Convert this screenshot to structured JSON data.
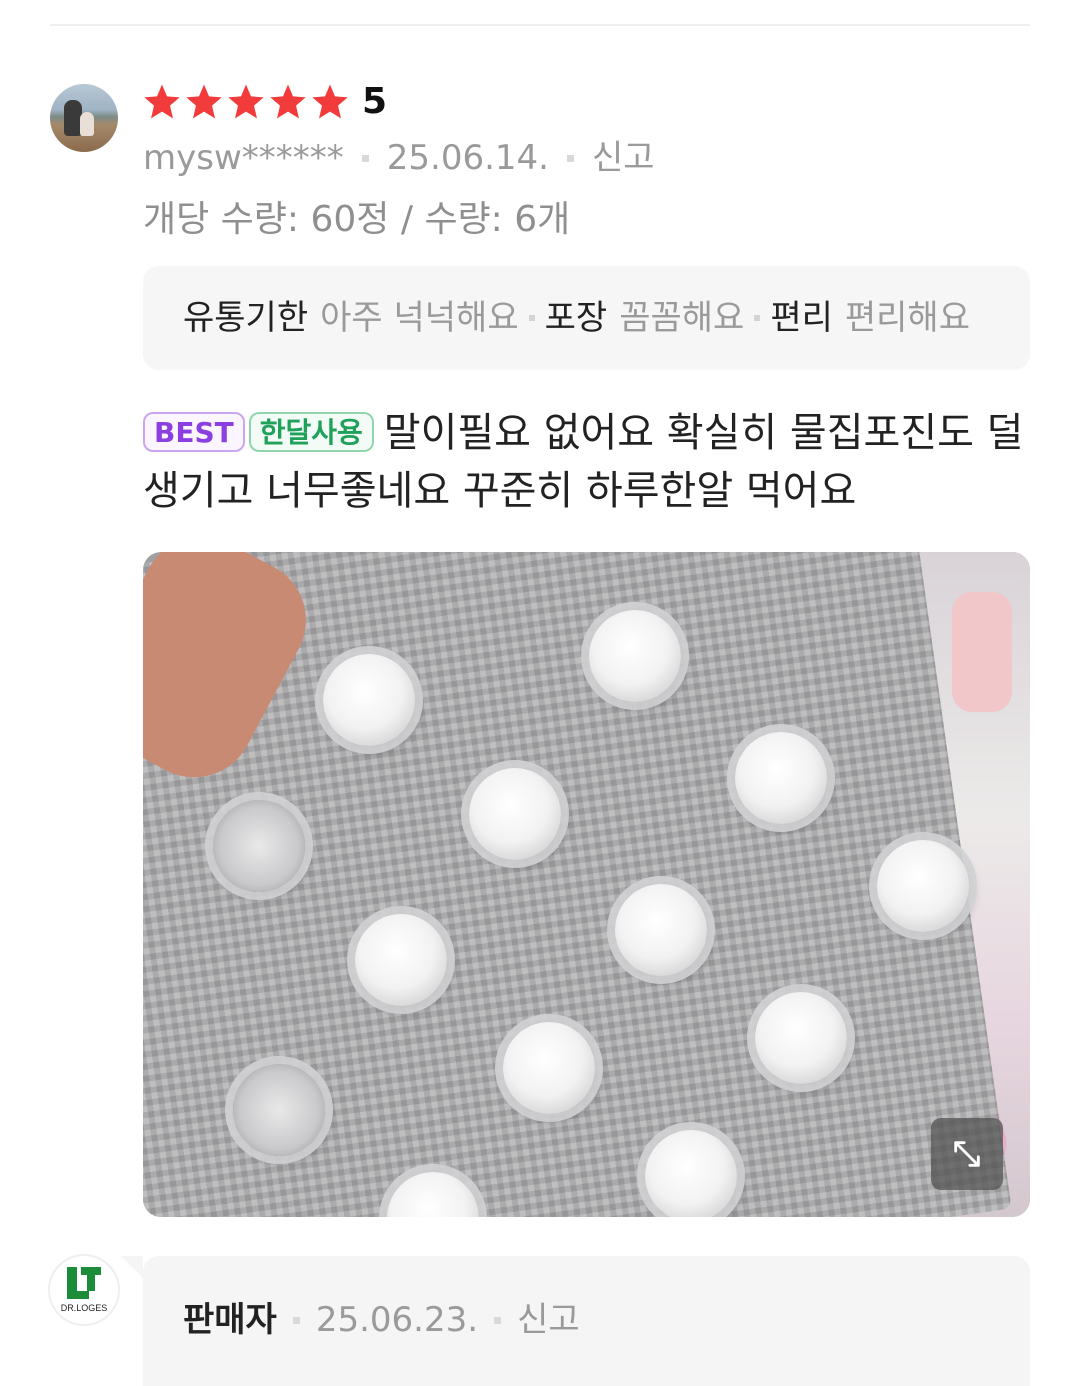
{
  "review": {
    "rating": 5,
    "rating_display": "5",
    "star_color": "#f23b3b",
    "user_id": "mysw******",
    "date": "25.06.14.",
    "report_label": "신고",
    "option_info": "개당 수량: 60정 / 수량: 6개",
    "attributes": [
      {
        "key": "유통기한",
        "value": "아주 넉넉해요"
      },
      {
        "key": "포장",
        "value": "꼼꼼해요"
      },
      {
        "key": "편리",
        "value": "편리해요"
      }
    ],
    "badges": {
      "best": "BEST",
      "month_use": "한달사용"
    },
    "text": "말이필요 없어요 확실히 물집포진도 덜생기고 너무좋네요 꾸준히 하루한알 먹어요",
    "photo": {
      "description_icon": "expand-icon"
    }
  },
  "seller_reply": {
    "logo_text": "DR.LOGES",
    "seller_label": "판매자",
    "date": "25.06.23.",
    "report_label": "신고"
  },
  "colors": {
    "best_badge": "#8b3fe0",
    "month_badge": "#1fa15a"
  }
}
